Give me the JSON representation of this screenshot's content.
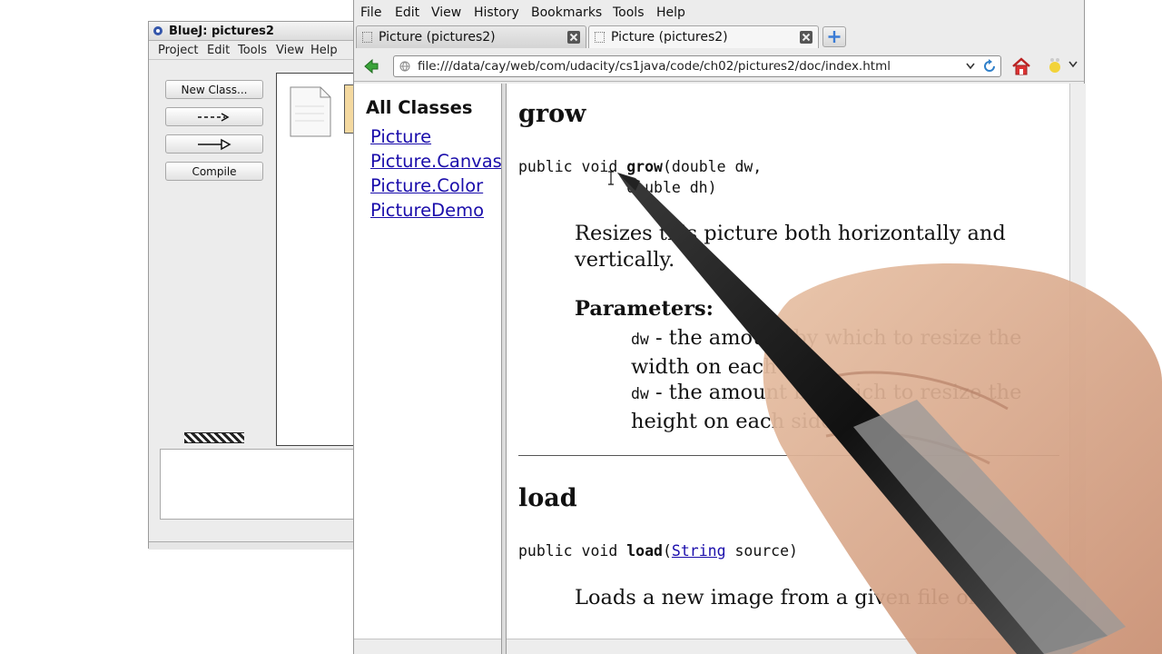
{
  "bluej": {
    "title": "BlueJ:  pictures2",
    "menu": [
      "Project",
      "Edit",
      "Tools",
      "View",
      "Help"
    ],
    "buttons": {
      "new_class": "New Class...",
      "dashed_arrow": "--->",
      "solid_arrow": "—▷",
      "compile": "Compile"
    }
  },
  "browser": {
    "menu": [
      "File",
      "Edit",
      "View",
      "History",
      "Bookmarks",
      "Tools",
      "Help"
    ],
    "tabs": [
      {
        "label": "Picture (pictures2)"
      },
      {
        "label": "Picture (pictures2)"
      }
    ],
    "url": "file:///data/cay/web/com/udacity/cs1java/code/ch02/pictures2/doc/index.html"
  },
  "left_frame": {
    "heading": "All Classes",
    "classes": [
      "Picture",
      "Picture.Canvas",
      "Picture.Color",
      "PictureDemo"
    ]
  },
  "content": {
    "grow": {
      "heading": "grow",
      "sig_prefix": "public void ",
      "sig_name": "grow",
      "sig_line1_rest": "(double dw,",
      "sig_line2": "            double dh)",
      "description": "Resizes this picture both horizontally and vertically.",
      "params_heading": "Parameters:",
      "params": [
        {
          "name": "dw",
          "text": " - the amount by which to resize the width on each side"
        },
        {
          "name": "dw",
          "text": " - the amount by which to resize the height on each side"
        }
      ]
    },
    "load": {
      "heading": "load",
      "sig_prefix": "public void ",
      "sig_name": "load",
      "sig_open": "(",
      "sig_type_link": "String",
      "sig_rest": " source)",
      "description": "Loads a new image from a given file or URL."
    }
  }
}
